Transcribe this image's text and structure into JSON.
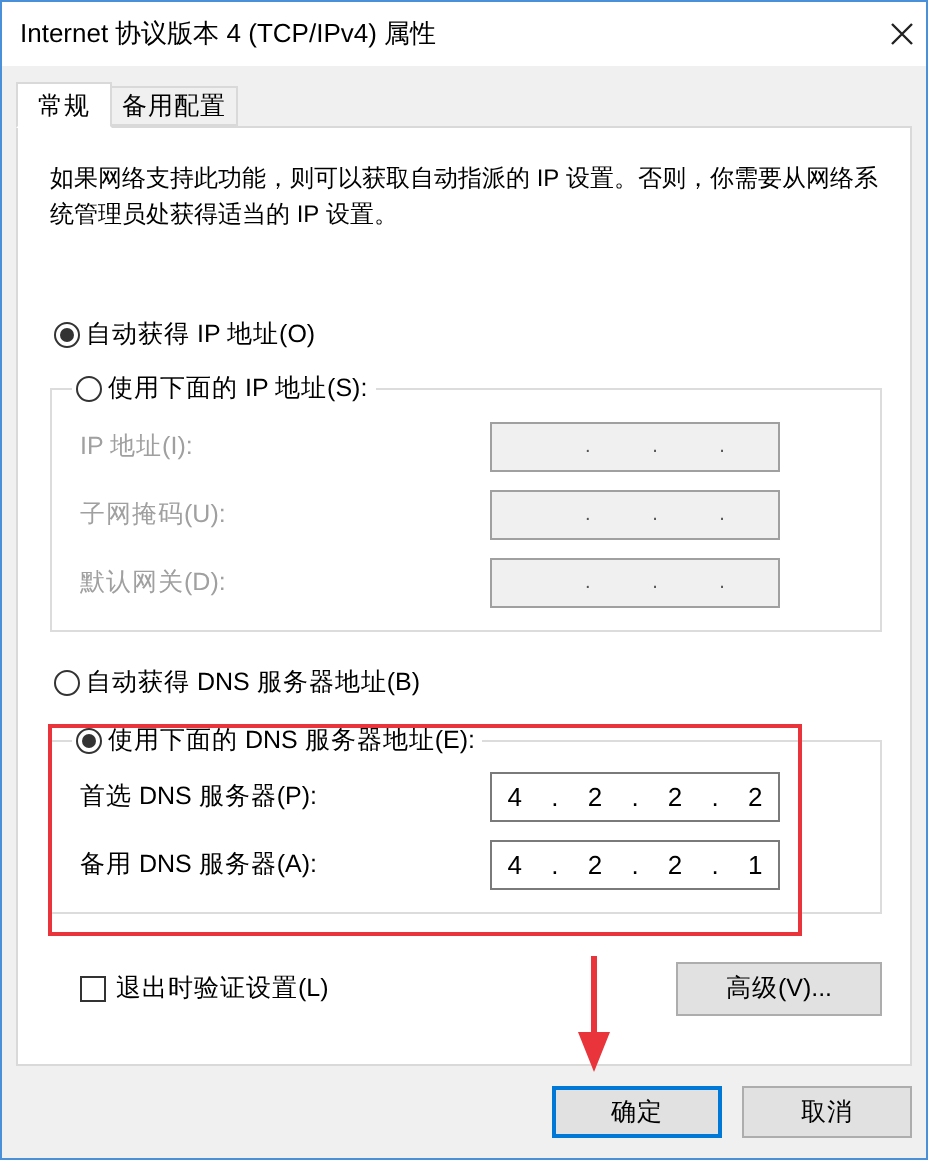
{
  "window": {
    "title": "Internet 协议版本 4 (TCP/IPv4) 属性"
  },
  "tabs": [
    {
      "label": "常规",
      "selected": true
    },
    {
      "label": "备用配置",
      "selected": false
    }
  ],
  "description": "如果网络支持此功能，则可以获取自动指派的 IP 设置。否则，你需要从网络系统管理员处获得适当的 IP 设置。",
  "ip_mode": [
    {
      "label": "自动获得 IP 地址(O)",
      "selected": true
    },
    {
      "label": "使用下面的 IP 地址(S):",
      "selected": false
    }
  ],
  "ip_fields": [
    {
      "label": "IP 地址(I):",
      "value": ". . .",
      "disabled": true
    },
    {
      "label": "子网掩码(U):",
      "value": ". . .",
      "disabled": true
    },
    {
      "label": "默认网关(D):",
      "value": ". . .",
      "disabled": true
    }
  ],
  "dns_mode": [
    {
      "label": "自动获得 DNS 服务器地址(B)",
      "selected": false
    },
    {
      "label": "使用下面的 DNS 服务器地址(E):",
      "selected": true
    }
  ],
  "dns_fields": [
    {
      "label": "首选 DNS 服务器(P):",
      "value": "4 . 2 . 2 . 2",
      "disabled": false
    },
    {
      "label": "备用 DNS 服务器(A):",
      "value": "4 . 2 . 2 . 1",
      "disabled": false
    }
  ],
  "validate_on_exit": {
    "label": "退出时验证设置(L)",
    "checked": false
  },
  "advanced_button": "高级(V)...",
  "buttons": [
    {
      "label": "确定",
      "default": true
    },
    {
      "label": "取消",
      "default": false
    }
  ]
}
